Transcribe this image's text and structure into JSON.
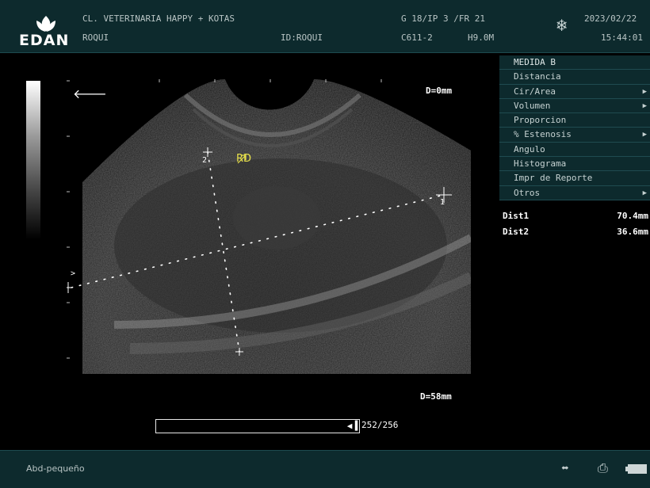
{
  "header": {
    "brand": "EDAN",
    "clinic": "CL. VETERINARIA HAPPY + KOTAS",
    "patient_name": "ROQUI",
    "patient_id": "ID:ROQUI",
    "gain_params": "G 18/IP 3 /FR 21",
    "probe": "C611-2",
    "frequency": "H9.0M",
    "date": "2023/02/22",
    "time": "15:44:01",
    "freeze_icon": "snowflake-icon"
  },
  "image": {
    "depth_top": "D=0mm",
    "depth_bottom": "D=58mm",
    "annotation": "RD",
    "marker_1": "1",
    "marker_2": "2",
    "focus_marker": ">",
    "cine_count": "252/256",
    "cine_fraction": 0.984
  },
  "menu": {
    "title": "MEDIDA B",
    "items": [
      {
        "label": "Distancia",
        "submenu": false
      },
      {
        "label": "Cir/Area",
        "submenu": true
      },
      {
        "label": "Volumen",
        "submenu": true
      },
      {
        "label": "Proporcion",
        "submenu": false
      },
      {
        "label": "% Estenosis",
        "submenu": true
      },
      {
        "label": "Angulo",
        "submenu": false
      },
      {
        "label": "Histograma",
        "submenu": false
      },
      {
        "label": "Impr de Reporte",
        "submenu": false
      },
      {
        "label": "Otros",
        "submenu": true
      }
    ]
  },
  "results": [
    {
      "label": "Dist1",
      "value": "70.4mm"
    },
    {
      "label": "Dist2",
      "value": "36.6mm"
    }
  ],
  "footer": {
    "preset": "Abd-pequeño",
    "icons": [
      "usb-icon",
      "printer-icon",
      "battery-icon"
    ]
  },
  "colors": {
    "panel": "#0d2a2d",
    "annotation": "#e7e04a"
  }
}
